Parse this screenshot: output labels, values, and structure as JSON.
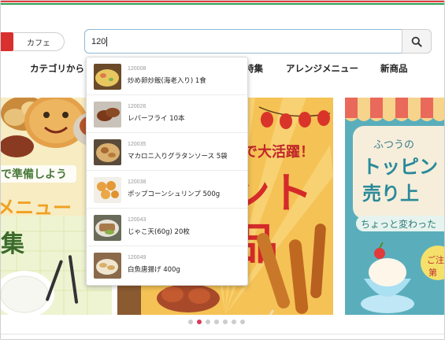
{
  "header": {
    "category_chip": "カフェ"
  },
  "search": {
    "value": "120"
  },
  "nav": {
    "items": [
      "カテゴリから",
      "特集",
      "アレンジメニュー",
      "新商品"
    ]
  },
  "suggestions": [
    {
      "code": "120008",
      "name": "炒め卵炒飯(海老入り) 1食"
    },
    {
      "code": "120026",
      "name": "レバーフライ 10本"
    },
    {
      "code": "120035",
      "name": "マカロニ入りグラタンソース 5袋"
    },
    {
      "code": "120038",
      "name": "ポップコーンシュリンプ 500g"
    },
    {
      "code": "120043",
      "name": "じゃこ天(60g) 20枚"
    },
    {
      "code": "120049",
      "name": "白魚唐揚げ 400g"
    }
  ],
  "banners": {
    "left": {
      "line1": "で準備しよう",
      "line2": "メニュー",
      "line3": "集"
    },
    "middle": {
      "line1": "で大活躍！",
      "line2": "ント",
      "line3": "品"
    },
    "right": {
      "line1": "ふつうの",
      "line2": "トッピン",
      "line3": "売り上",
      "line4": "ちょっと変わった",
      "badge": "ご注\n第"
    }
  },
  "carousel": {
    "total": 7,
    "active": 2
  },
  "colors": {
    "accent_red": "#d82f2f",
    "search_border": "#8fb8d8",
    "dot_active": "#d83a5a"
  }
}
